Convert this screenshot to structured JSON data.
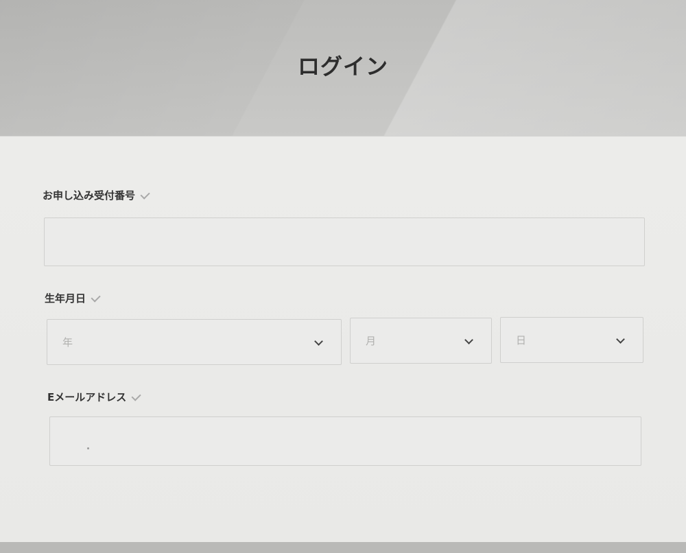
{
  "header": {
    "title": "ログイン"
  },
  "form": {
    "application_number": {
      "label": "お申し込み受付番号",
      "value": ""
    },
    "birth_date": {
      "label": "生年月日",
      "year": {
        "value": "年"
      },
      "month": {
        "value": "月"
      },
      "day": {
        "value": "日"
      }
    },
    "email": {
      "label": "Eメールアドレス",
      "value": ""
    }
  },
  "icons": {
    "check": "check-icon",
    "dropdown": "chevron-down-icon"
  },
  "colors": {
    "header_bg": "#c4c4c2",
    "form_bg": "#ebebe9",
    "input_border": "#cfcfcd",
    "text": "#333333",
    "placeholder": "#b0b0ae"
  }
}
